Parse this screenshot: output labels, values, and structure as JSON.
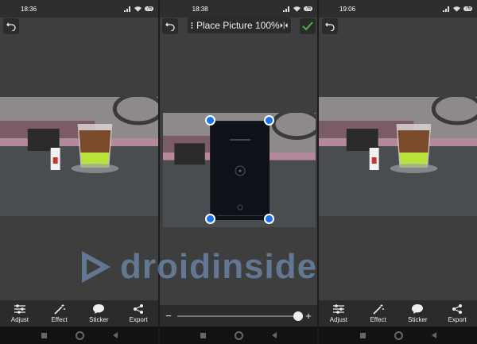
{
  "screens": [
    {
      "status_time": "18:36",
      "battery": "76",
      "tools": [
        {
          "label": "Adjust",
          "icon": "sliders-icon"
        },
        {
          "label": "Effect",
          "icon": "magic-wand-icon"
        },
        {
          "label": "Sticker",
          "icon": "chat-bubble-icon"
        },
        {
          "label": "Export",
          "icon": "share-icon"
        }
      ]
    },
    {
      "status_time": "18:38",
      "battery": "76",
      "toolbar_label": "Place Picture 100%",
      "slider_min_label": "−",
      "slider_max_label": "+",
      "slider_value": 1.0
    },
    {
      "status_time": "19:06",
      "battery": "76",
      "tools": [
        {
          "label": "Adjust",
          "icon": "sliders-icon"
        },
        {
          "label": "Effect",
          "icon": "magic-wand-icon"
        },
        {
          "label": "Sticker",
          "icon": "chat-bubble-icon"
        },
        {
          "label": "Export",
          "icon": "share-icon"
        }
      ]
    }
  ],
  "watermark": "droidinside",
  "colors": {
    "handle": "#1a73e8",
    "accept": "#4caf50",
    "panel_bg": "#3e3e3e",
    "toolbar_bg": "#2b2b2b"
  }
}
